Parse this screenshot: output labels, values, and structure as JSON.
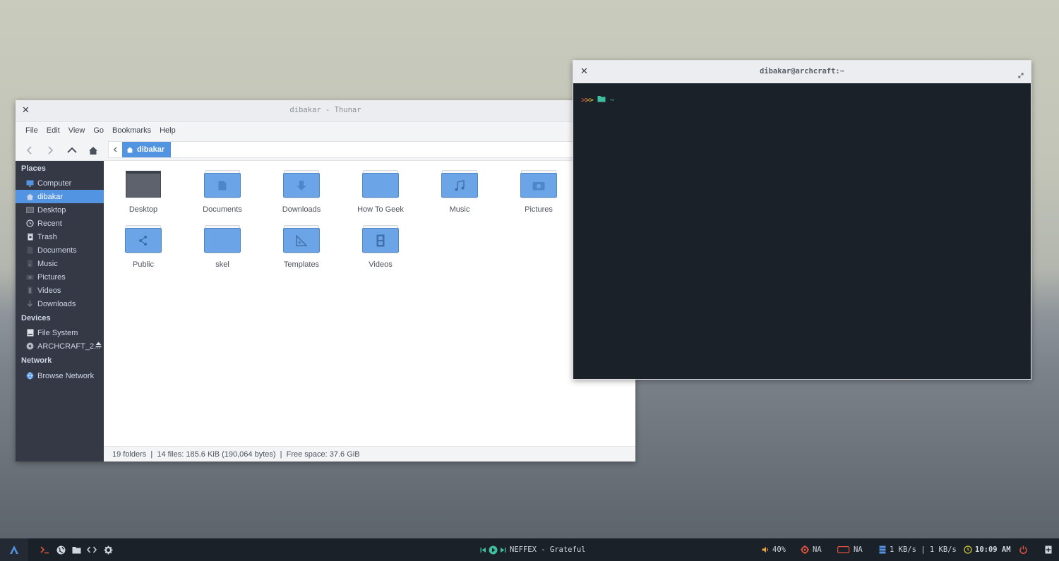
{
  "thunar": {
    "title": "dibakar - Thunar",
    "menu": [
      "File",
      "Edit",
      "View",
      "Go",
      "Bookmarks",
      "Help"
    ],
    "path": "dibakar",
    "sidebar": {
      "places_title": "Places",
      "places": [
        "Computer",
        "dibakar",
        "Desktop",
        "Recent",
        "Trash",
        "Documents",
        "Music",
        "Pictures",
        "Videos",
        "Downloads"
      ],
      "active": "dibakar",
      "devices_title": "Devices",
      "devices": [
        "File System",
        "ARCHCRAFT_2..."
      ],
      "network_title": "Network",
      "network": [
        "Browse Network"
      ]
    },
    "files": [
      "Desktop",
      "Documents",
      "Downloads",
      "How To Geek",
      "Music",
      "Pictures",
      "Public",
      "skel",
      "Templates",
      "Videos"
    ],
    "status": "19 folders  |  14 files: 185.6 KiB (190,064 bytes)  |  Free space: 37.6 GiB"
  },
  "terminal": {
    "title": "dibakar@archcraft:~",
    "prompt_chevrons": ">>>",
    "prompt_path": "~"
  },
  "taskbar": {
    "media_text": "NEFFEX - Grateful",
    "volume": "40%",
    "cpu": "NA",
    "battery": "NA",
    "network": "1 KB/s | 1 KB/s",
    "clock": "10:09 AM"
  },
  "colors": {
    "accent": "#5294e2",
    "sidebar_bg": "#353945",
    "terminal_bg": "#1b2128",
    "folder_blue": "#6ba4e7"
  }
}
